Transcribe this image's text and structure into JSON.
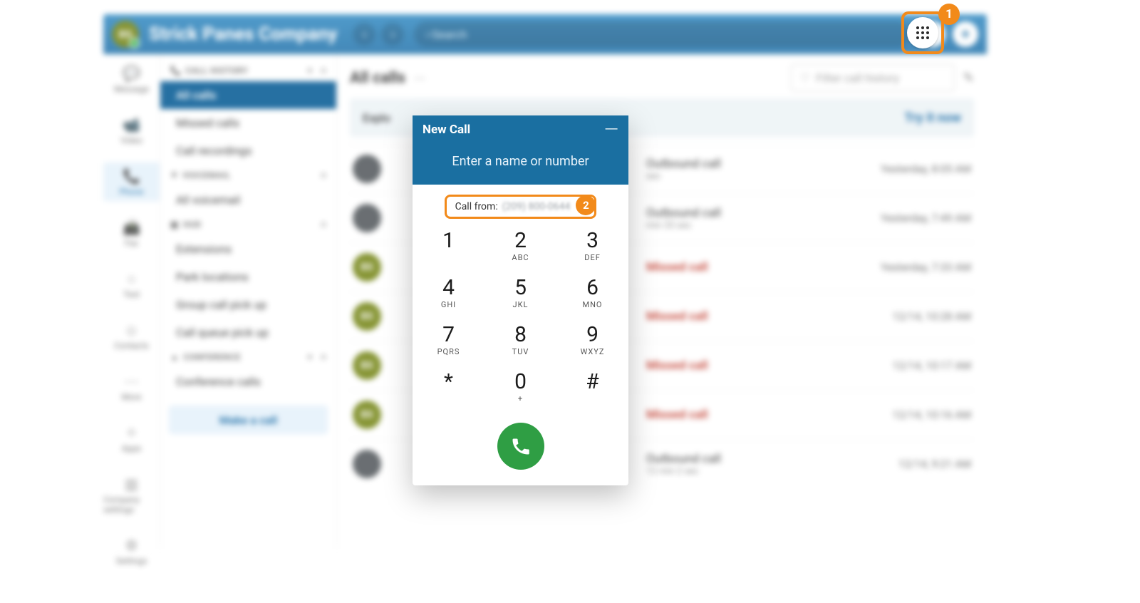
{
  "header": {
    "avatar_initials": "BS",
    "company": "Strick Panes Company",
    "search_placeholder": "Search",
    "plus_label": "+"
  },
  "rail": {
    "items": [
      "Message",
      "Video",
      "Phone",
      "Fax",
      "Text",
      "Contacts",
      "More",
      "Apps",
      "Company settings",
      "Settings"
    ]
  },
  "side": {
    "sect_call_history": "CALL HISTORY",
    "all_calls": "All calls",
    "missed_calls": "Missed calls",
    "call_recordings": "Call recordings",
    "sect_voicemail": "VOICEMAIL",
    "all_voicemail": "All voicemail",
    "sect_hud": "HUD",
    "extensions": "Extensions",
    "park_locations": "Park locations",
    "group_call_pick_up": "Group call pick up",
    "call_queue_pick_up": "Call queue pick up",
    "sect_conference": "CONFERENCE",
    "conference_calls": "Conference calls",
    "make_a_call": "Make a call"
  },
  "main": {
    "title": "All calls",
    "filter_placeholder": "Filter call history",
    "banner_left": "Explo",
    "banner_cta": "Try it now"
  },
  "calls": [
    {
      "av": "photo",
      "type": "Outbound call",
      "type_class": "",
      "sub": "sec",
      "time": "Yesterday, 8:05 AM"
    },
    {
      "av": "photo",
      "type": "Outbound call",
      "type_class": "",
      "sub": "min 33 sec",
      "time": "Yesterday, 7:49 AM"
    },
    {
      "av": "bs",
      "type": "Missed call",
      "type_class": "missed",
      "sub": "",
      "time": "Yesterday, 7:33 AM"
    },
    {
      "av": "bs",
      "type": "Missed call",
      "type_class": "missed",
      "sub": "",
      "time": "12/14, 10:28 AM"
    },
    {
      "av": "bs",
      "type": "Missed call",
      "type_class": "missed",
      "sub": "",
      "time": "12/14, 10:17 AM"
    },
    {
      "av": "bs",
      "type": "Missed call",
      "type_class": "missed",
      "sub": "",
      "time": "12/14, 10:16 AM"
    },
    {
      "av": "photo",
      "type": "Outbound call",
      "type_class": "",
      "sub": "12 min 2 sec",
      "time": "12/14, 9:21 AM"
    }
  ],
  "dialpad": {
    "title": "New Call",
    "prompt": "Enter a name or number",
    "call_from_label": "Call from:",
    "call_from_number": "(209) 800-0644",
    "keys": [
      {
        "d": "1",
        "l": ""
      },
      {
        "d": "2",
        "l": "ABC"
      },
      {
        "d": "3",
        "l": "DEF"
      },
      {
        "d": "4",
        "l": "GHI"
      },
      {
        "d": "5",
        "l": "JKL"
      },
      {
        "d": "6",
        "l": "MNO"
      },
      {
        "d": "7",
        "l": "PQRS"
      },
      {
        "d": "8",
        "l": "TUV"
      },
      {
        "d": "9",
        "l": "WXYZ"
      },
      {
        "d": "*",
        "l": ""
      },
      {
        "d": "0",
        "l": "+"
      },
      {
        "d": "#",
        "l": ""
      }
    ]
  },
  "callouts": {
    "one": "1",
    "two": "2"
  }
}
